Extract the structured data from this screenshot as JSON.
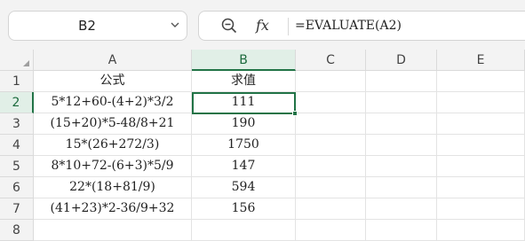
{
  "name_box": {
    "cell_ref": "B2"
  },
  "formula_bar": {
    "formula": "=EVALUATE(A2)",
    "fx_label": "fx"
  },
  "columns": [
    "A",
    "B",
    "C",
    "D",
    "E"
  ],
  "rows": [
    "1",
    "2",
    "3",
    "4",
    "5",
    "6",
    "7",
    "8"
  ],
  "cells": [
    [
      "公式",
      "求值"
    ],
    [
      "5*12+60-(4+2)*3/2",
      "111"
    ],
    [
      "(15+20)*5-48/8+21",
      "190"
    ],
    [
      "15*(26+272/3)",
      "1750"
    ],
    [
      "8*10+72-(6+3)*5/9",
      "147"
    ],
    [
      "22*(18+81/9)",
      "594"
    ],
    [
      "(41+23)*2-36/9+32",
      "156"
    ],
    [
      "",
      ""
    ]
  ],
  "selection": {
    "column": "B",
    "row": "2"
  },
  "colors": {
    "accent": "#217346",
    "header_bg": "#f3f3f3",
    "selected_header_bg": "#e1efe7"
  }
}
